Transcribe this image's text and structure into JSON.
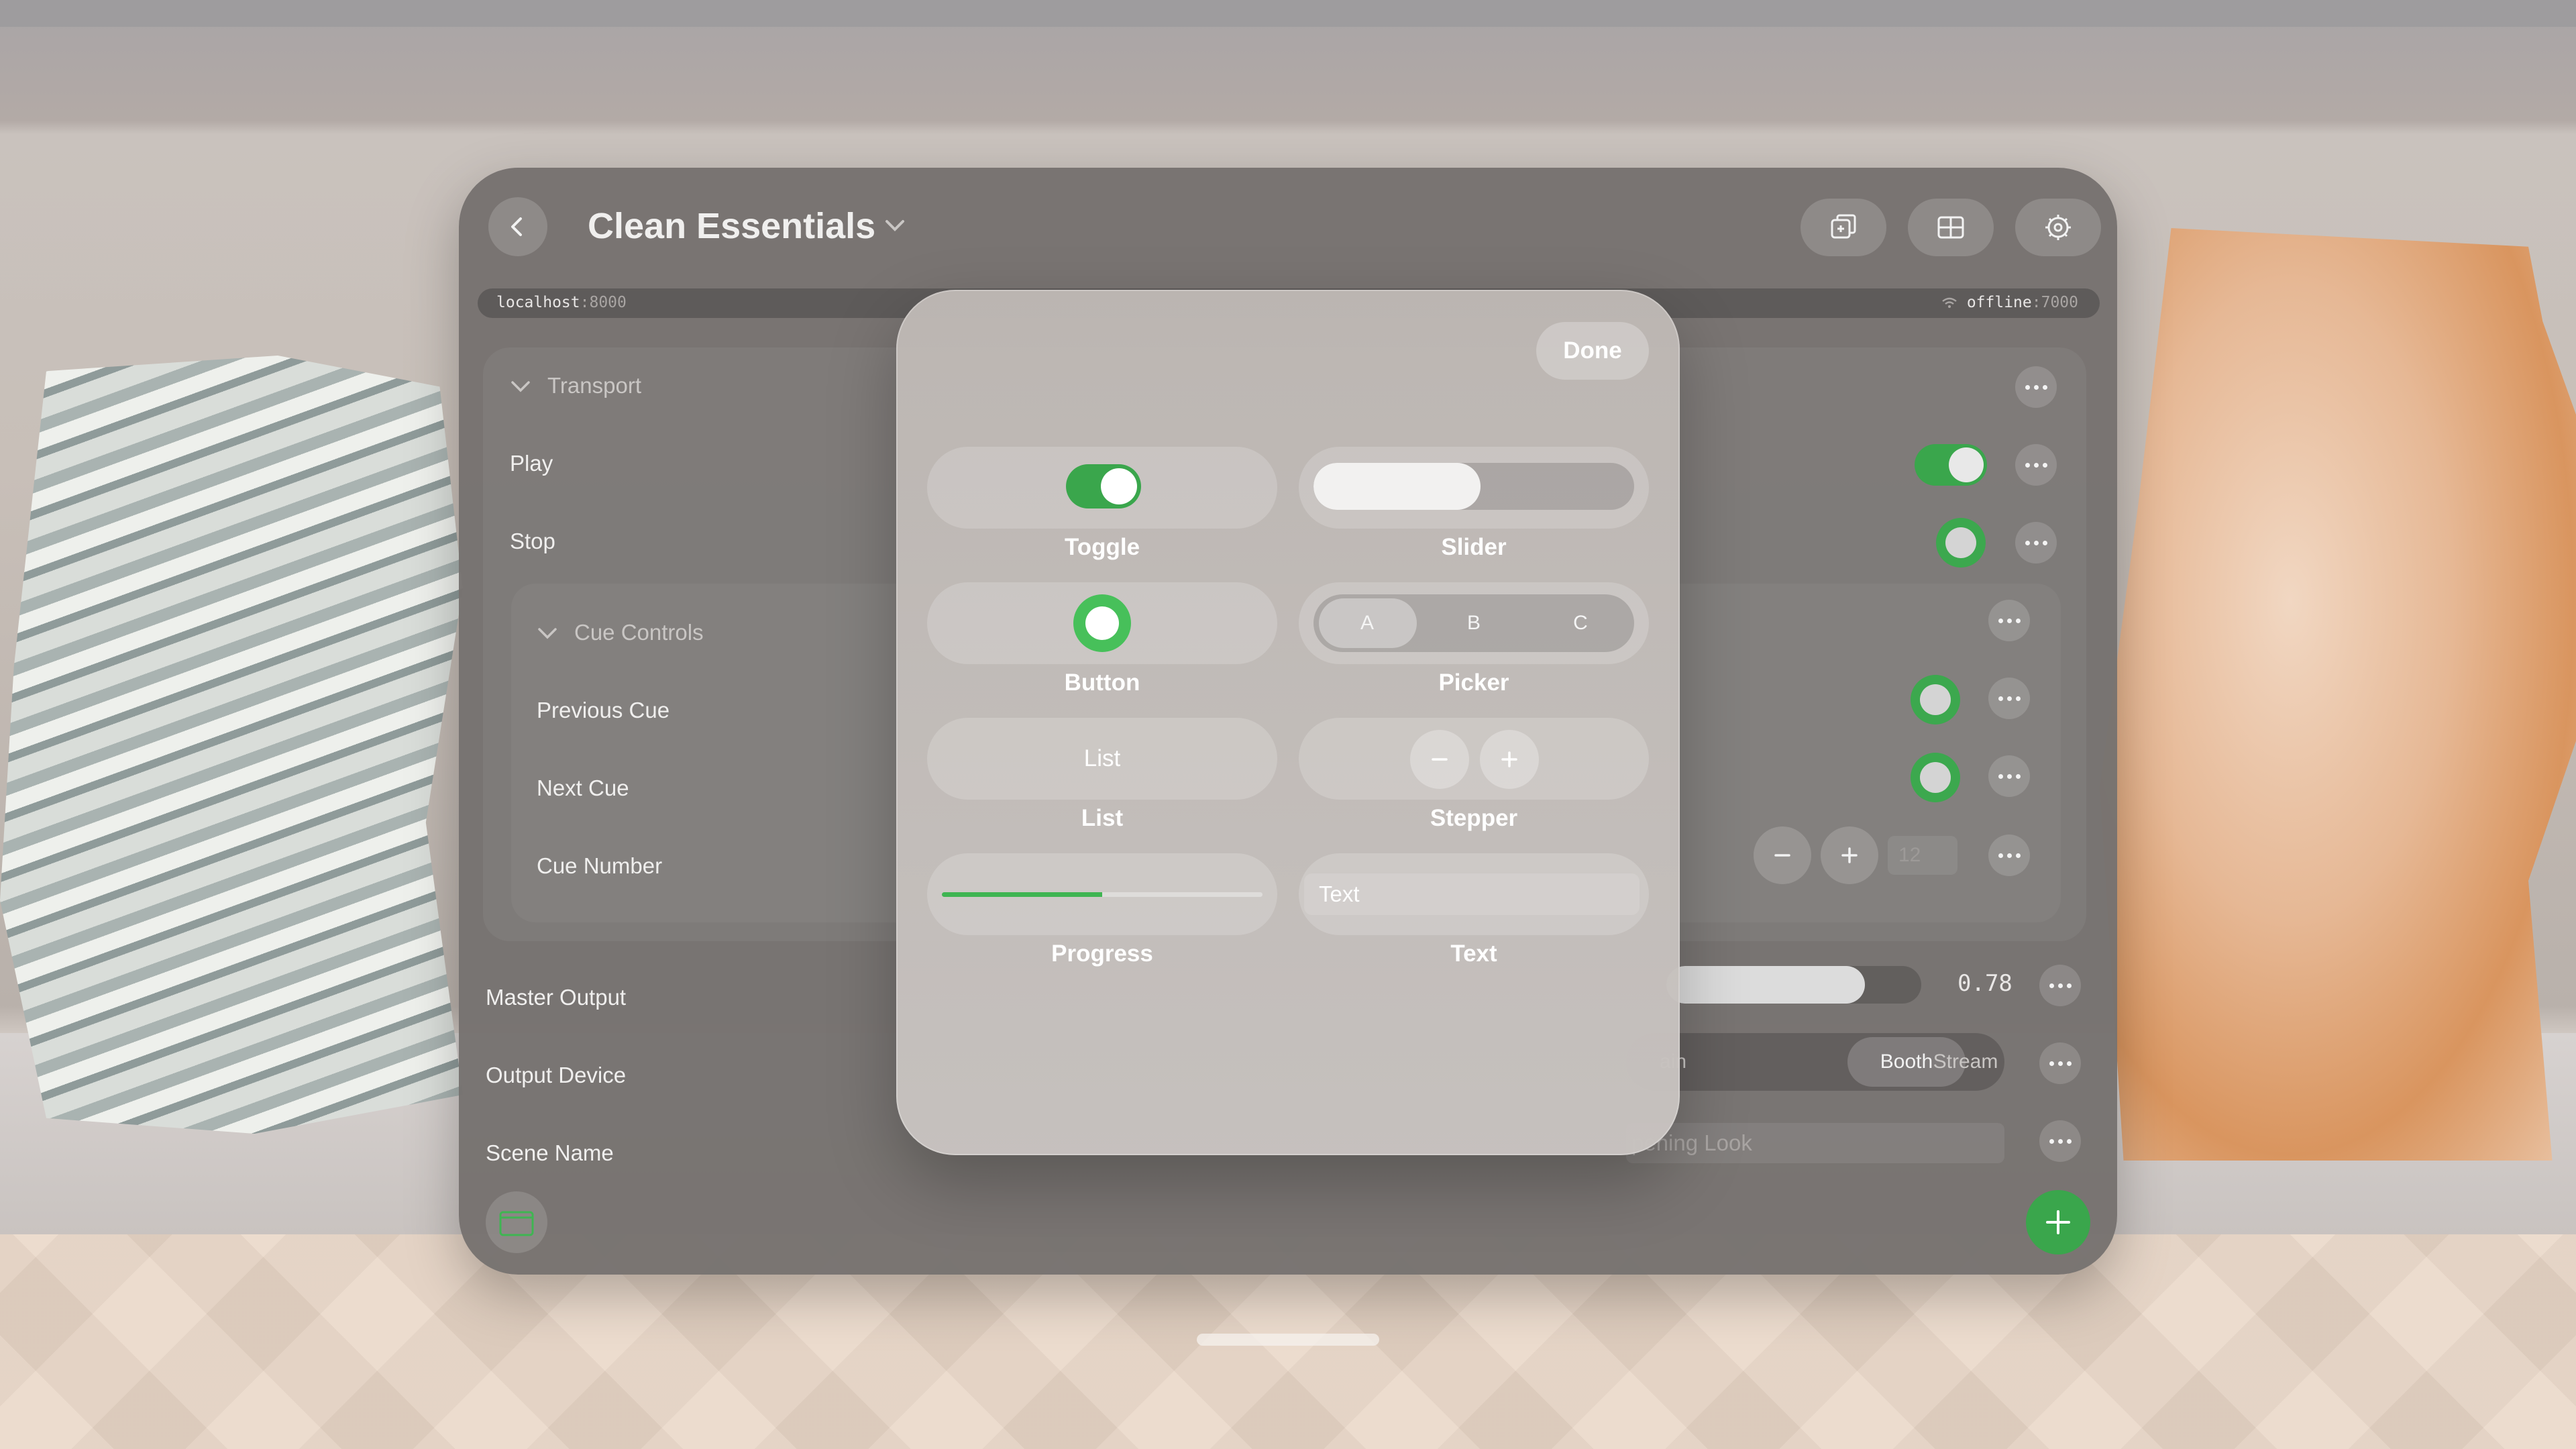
{
  "window": {
    "title": "Clean Essentials",
    "url_left": {
      "host": "localhost",
      "port": ":8000"
    },
    "url_right": {
      "host": "offline",
      "port": ":7000"
    }
  },
  "sections": {
    "transport": {
      "label": "Transport"
    },
    "cue_controls": {
      "label": "Cue Controls"
    }
  },
  "rows": {
    "play": {
      "label": "Play",
      "toggle_on": true
    },
    "stop": {
      "label": "Stop"
    },
    "previous_cue": {
      "label": "Previous Cue"
    },
    "next_cue": {
      "label": "Next Cue"
    },
    "cue_number": {
      "label": "Cue Number",
      "value": "12"
    },
    "master_output": {
      "label": "Master Output",
      "value_text": "0.78",
      "value": 0.78
    },
    "output_device": {
      "label": "Output Device",
      "options": [
        "ain",
        "Booth",
        "Stream"
      ],
      "selected": "Booth"
    },
    "scene_name": {
      "label": "Scene Name",
      "value": "pening Look"
    }
  },
  "popup": {
    "done_label": "Done",
    "cells": {
      "toggle": {
        "label": "Toggle",
        "on": true
      },
      "slider": {
        "label": "Slider",
        "value": 0.52
      },
      "button": {
        "label": "Button"
      },
      "picker": {
        "label": "Picker",
        "options": [
          "A",
          "B",
          "C"
        ],
        "selected": "A"
      },
      "list": {
        "label": "List",
        "button_text": "List"
      },
      "stepper": {
        "label": "Stepper"
      },
      "progress": {
        "label": "Progress",
        "value": 0.5
      },
      "text": {
        "label": "Text",
        "field_value": "Text"
      }
    }
  },
  "colors": {
    "accent_green": "#3aa64c",
    "window_bg": "#767270"
  },
  "icons": {
    "back": "chevron-left-icon",
    "title_menu": "chevron-down-icon",
    "duplicate": "duplicate-window-icon",
    "layout": "grid-layout-icon",
    "settings": "gear-icon",
    "wifi": "wifi-icon",
    "more": "ellipsis-icon",
    "add": "plus-icon",
    "scene": "calendar-icon"
  }
}
